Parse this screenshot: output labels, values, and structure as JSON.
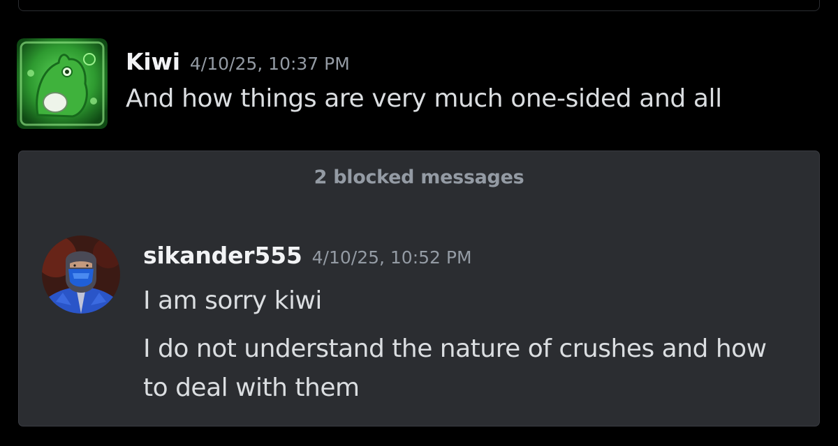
{
  "messages": {
    "kiwi": {
      "username": "Kiwi",
      "timestamp": "4/10/25, 10:37 PM",
      "text": "And how things are very much one-sided and all"
    },
    "blocked": {
      "label": "2 blocked messages"
    },
    "sikander": {
      "username": "sikander555",
      "timestamp": "4/10/25, 10:52 PM",
      "lines": [
        "I am sorry kiwi",
        "I do not understand the nature of crushes and how",
        "to deal with them"
      ]
    }
  },
  "colors": {
    "background": "#000000",
    "panel": "#2b2d31",
    "username": "#f2f3f5",
    "timestamp": "#949ba4",
    "text": "#dbdee1"
  },
  "icons": {
    "kiwi_avatar": "green-frog-avatar-icon",
    "sikander_avatar": "masked-ninja-avatar-icon"
  }
}
